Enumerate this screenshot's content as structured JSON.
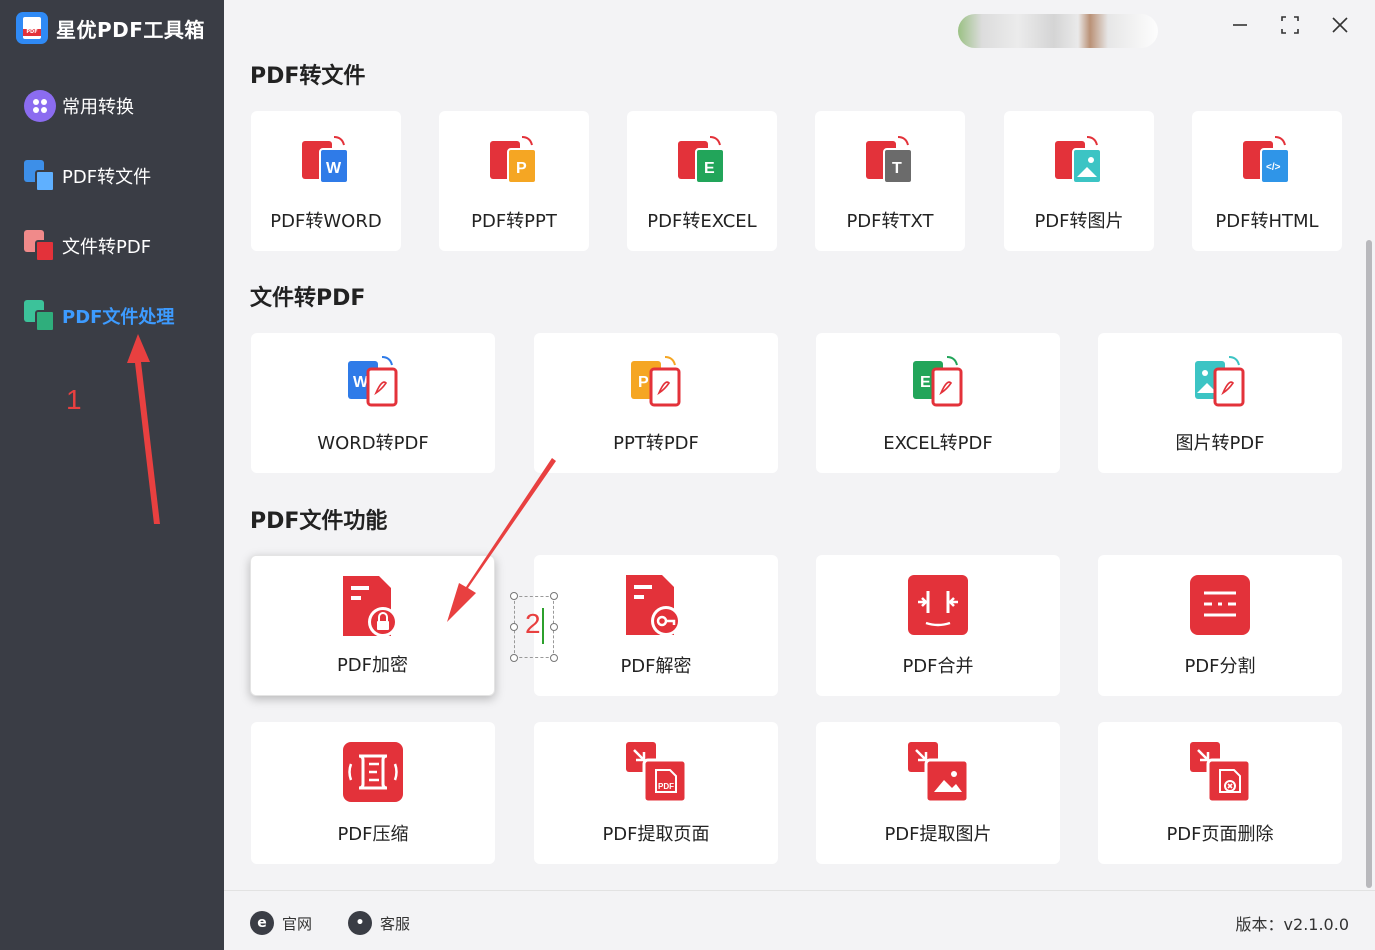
{
  "app": {
    "title": "星优PDF工具箱"
  },
  "sidebar": {
    "items": [
      {
        "label": "常用转换",
        "icon": "grid-circle-icon"
      },
      {
        "label": "PDF转文件",
        "icon": "pdf-to-file-icon"
      },
      {
        "label": "文件转PDF",
        "icon": "file-to-pdf-icon"
      },
      {
        "label": "PDF文件处理",
        "icon": "pdf-process-icon",
        "active": true
      }
    ]
  },
  "annotations": {
    "step1": "1",
    "step2": "2"
  },
  "sections": {
    "pdf_to_file": {
      "title": "PDF转文件",
      "cards": [
        "PDF转WORD",
        "PDF转PPT",
        "PDF转EXCEL",
        "PDF转TXT",
        "PDF转图片",
        "PDF转HTML"
      ]
    },
    "file_to_pdf": {
      "title": "文件转PDF",
      "cards": [
        "WORD转PDF",
        "PPT转PDF",
        "EXCEL转PDF",
        "图片转PDF"
      ]
    },
    "pdf_functions": {
      "title": "PDF文件功能",
      "cards": [
        "PDF加密",
        "PDF解密",
        "PDF合并",
        "PDF分割",
        "PDF压缩",
        "PDF提取页面",
        "PDF提取图片",
        "PDF页面删除"
      ]
    }
  },
  "footer": {
    "website": "官网",
    "support": "客服",
    "version": "版本：v2.1.0.0"
  },
  "colors": {
    "sidebar": "#3a3d45",
    "accent": "#3d9bff",
    "pdf_red": "#e3323a",
    "annotation": "#e84040"
  }
}
